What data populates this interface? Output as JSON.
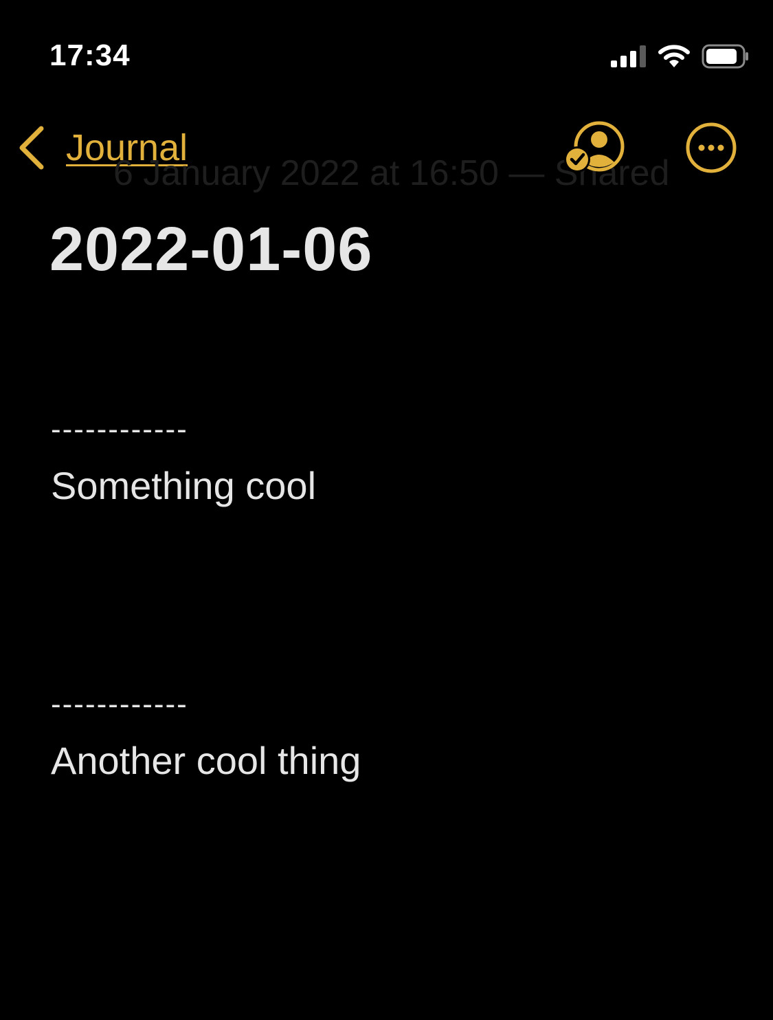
{
  "status_bar": {
    "time": "17:34"
  },
  "nav": {
    "back_label": "Journal",
    "subtitle": "6 January 2022 at 16:50 — Shared"
  },
  "note": {
    "title": "2022-01-06",
    "lines": [
      {
        "divider": "------------",
        "text": "Something cool"
      },
      {
        "divider": "------------",
        "text": "Another cool thing"
      }
    ]
  },
  "colors": {
    "accent": "#e2b13c",
    "background": "#000000",
    "text": "#e6e6e6"
  },
  "icons": {
    "back": "chevron-left-icon",
    "collaboration": "person-checkmark-icon",
    "more": "ellipsis-circle-icon",
    "signal": "cellular-signal-icon",
    "wifi": "wifi-icon",
    "battery": "battery-icon"
  }
}
